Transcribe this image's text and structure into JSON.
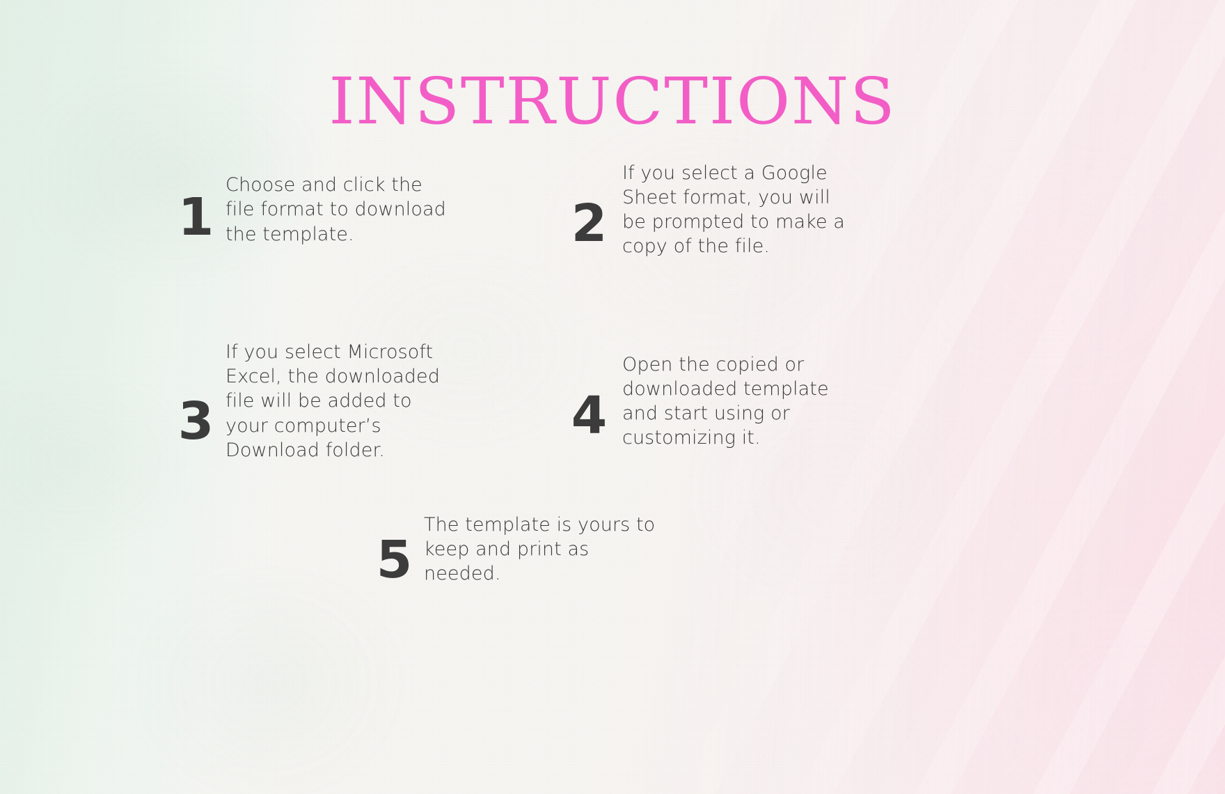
{
  "page": {
    "title": "INSTRUCTIONS",
    "title_color": "#f25ec6",
    "number_color": "#3c3c3c",
    "body_text_color": "#3a3a3a",
    "background_left_color": "#e4f0e8",
    "background_center_color": "#f5f3f0",
    "background_right_color": "#faeef1"
  },
  "steps": [
    {
      "number": "1",
      "text": "Choose and click the\nfile format to download\nthe template."
    },
    {
      "number": "2",
      "text": "If you select a Google\nSheet format, you will\nbe prompted to make a\ncopy of the file."
    },
    {
      "number": "3",
      "text": "If you select Microsoft\nExcel, the downloaded\nfile will be added to\nyour computer’s\nDownload  folder."
    },
    {
      "number": "4",
      "text": "Open the copied or\ndownloaded template\nand start using or\ncustomizing it."
    },
    {
      "number": "5",
      "text": "The template is yours to\nkeep and print as\nneeded."
    }
  ]
}
